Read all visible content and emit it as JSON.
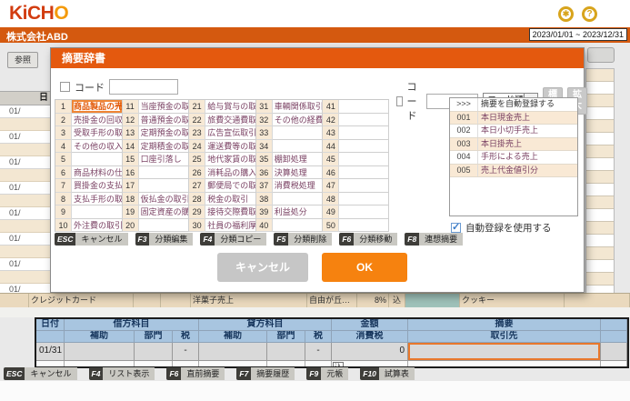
{
  "colors": {
    "brand_orange": "#e4590e",
    "ok_orange": "#f6820f",
    "gold_icon": "#d8a41c",
    "beige_cell": "#f7e9d5",
    "table_header_blue": "#a8c5e0",
    "teal_highlight": "#9fc2ba",
    "selected_border": "#ef8535"
  },
  "header": {
    "logo_main": "KiCH",
    "logo_o": "O",
    "company": "株式会社ABD",
    "date_range": "2023/01/01 ~ 2023/12/31",
    "settings_icon": "✱",
    "help_icon": "?"
  },
  "background": {
    "reference_button": "参照",
    "date_column_header": "日",
    "dates": [
      "01/",
      "01/",
      "01/",
      "01/",
      "01/",
      "01/",
      "01/",
      "01/"
    ],
    "detail_row": {
      "card": "クレジットカード",
      "item": "洋菓子売上",
      "branch": "自由が丘…",
      "tax_rate": "8%",
      "tax_badge": "込",
      "product": "クッキー"
    }
  },
  "modal": {
    "title": "摘要辞書",
    "code_filter_left": {
      "label": "コード",
      "value": ""
    },
    "code_filter_right": {
      "label": "コード",
      "value": ""
    },
    "sort_select": {
      "value": "コード順",
      "arrow": "▼"
    },
    "size_buttons": {
      "standard": "標準",
      "enlarge": "拡大"
    },
    "categories": {
      "col1": [
        {
          "n": "1",
          "label": "商品製品の売上",
          "selected": true
        },
        {
          "n": "2",
          "label": "売掛金の回収"
        },
        {
          "n": "3",
          "label": "受取手形の取引"
        },
        {
          "n": "4",
          "label": "その他の収入"
        },
        {
          "n": "5",
          "label": ""
        },
        {
          "n": "6",
          "label": "商品材料の仕入"
        },
        {
          "n": "7",
          "label": "買掛金の支払"
        },
        {
          "n": "8",
          "label": "支払手形の取引"
        },
        {
          "n": "9",
          "label": ""
        },
        {
          "n": "10",
          "label": "外注費の取引"
        }
      ],
      "col2": [
        {
          "n": "11",
          "label": "当座預金の取引"
        },
        {
          "n": "12",
          "label": "普通預金の取引"
        },
        {
          "n": "13",
          "label": "定期預金の取引"
        },
        {
          "n": "14",
          "label": "定期積金の取引"
        },
        {
          "n": "15",
          "label": "口座引落し"
        },
        {
          "n": "16",
          "label": ""
        },
        {
          "n": "17",
          "label": ""
        },
        {
          "n": "18",
          "label": "仮払金の取引"
        },
        {
          "n": "19",
          "label": "固定資産の購入"
        },
        {
          "n": "20",
          "label": ""
        }
      ],
      "col3": [
        {
          "n": "21",
          "label": "給与賞与の取引"
        },
        {
          "n": "22",
          "label": "旅費交通費取引"
        },
        {
          "n": "23",
          "label": "広告宣伝取引"
        },
        {
          "n": "24",
          "label": "運送費等の取引"
        },
        {
          "n": "25",
          "label": "地代家賃の取引"
        },
        {
          "n": "26",
          "label": "消耗品の購入"
        },
        {
          "n": "27",
          "label": "郵便局での取引"
        },
        {
          "n": "28",
          "label": "税金の取引"
        },
        {
          "n": "29",
          "label": "接待交際費取引"
        },
        {
          "n": "30",
          "label": "社員の福利厚生"
        }
      ],
      "col4": [
        {
          "n": "31",
          "label": "車輌関係取引"
        },
        {
          "n": "32",
          "label": "その他の経費"
        },
        {
          "n": "33",
          "label": ""
        },
        {
          "n": "34",
          "label": ""
        },
        {
          "n": "35",
          "label": "棚卸処理"
        },
        {
          "n": "36",
          "label": "決算処理"
        },
        {
          "n": "37",
          "label": "消費税処理"
        },
        {
          "n": "38",
          "label": ""
        },
        {
          "n": "39",
          "label": "利益処分"
        },
        {
          "n": "40",
          "label": ""
        }
      ],
      "col5": [
        {
          "n": "41",
          "label": ""
        },
        {
          "n": "42",
          "label": ""
        },
        {
          "n": "43",
          "label": ""
        },
        {
          "n": "44",
          "label": ""
        },
        {
          "n": "45",
          "label": ""
        },
        {
          "n": "46",
          "label": ""
        },
        {
          "n": "47",
          "label": ""
        },
        {
          "n": "48",
          "label": ""
        },
        {
          "n": "49",
          "label": ""
        },
        {
          "n": "50",
          "label": ""
        }
      ]
    },
    "summary_list": {
      "header": {
        "num": ">>>",
        "label": "摘要を自動登録する"
      },
      "items": [
        {
          "num": "001",
          "label": "本日現金売上",
          "shaded": true
        },
        {
          "num": "002",
          "label": "本日小切手売上"
        },
        {
          "num": "003",
          "label": "本日掛売上",
          "shaded": true
        },
        {
          "num": "004",
          "label": "手形による売上"
        },
        {
          "num": "005",
          "label": "売上代金値引分",
          "shaded": true
        }
      ]
    },
    "auto_register": {
      "checked": true,
      "check_glyph": "✓",
      "label": "自動登録を使用する"
    },
    "function_keys": [
      {
        "key": "ESC",
        "label": "キャンセル"
      },
      {
        "key": "F3",
        "label": "分類編集"
      },
      {
        "key": "F4",
        "label": "分類コピー"
      },
      {
        "key": "F5",
        "label": "分類削除"
      },
      {
        "key": "F6",
        "label": "分類移動"
      },
      {
        "key": "F8",
        "label": "連想摘要"
      }
    ],
    "cancel_button": "キャンセル",
    "ok_button": "OK"
  },
  "entry_table": {
    "header_row1": [
      "日付",
      "借方科目",
      "貸方科目",
      "金額",
      "摘要"
    ],
    "header_row2": [
      "補助",
      "部門",
      "税",
      "補助",
      "部門",
      "税",
      "消費税",
      "取引先"
    ],
    "row1": {
      "date": "01/31",
      "debit_tax": "-",
      "credit_tax": "-",
      "amount": "0",
      "summary": ""
    },
    "row2": {
      "tax_badge": "込"
    }
  },
  "bottom_function_keys": [
    {
      "key": "ESC",
      "label": "キャンセル"
    },
    {
      "key": "F4",
      "label": "リスト表示"
    },
    {
      "key": "F6",
      "label": "直前摘要"
    },
    {
      "key": "F7",
      "label": "摘要履歴"
    },
    {
      "key": "F9",
      "label": "元帳"
    },
    {
      "key": "F10",
      "label": "試算表"
    }
  ]
}
